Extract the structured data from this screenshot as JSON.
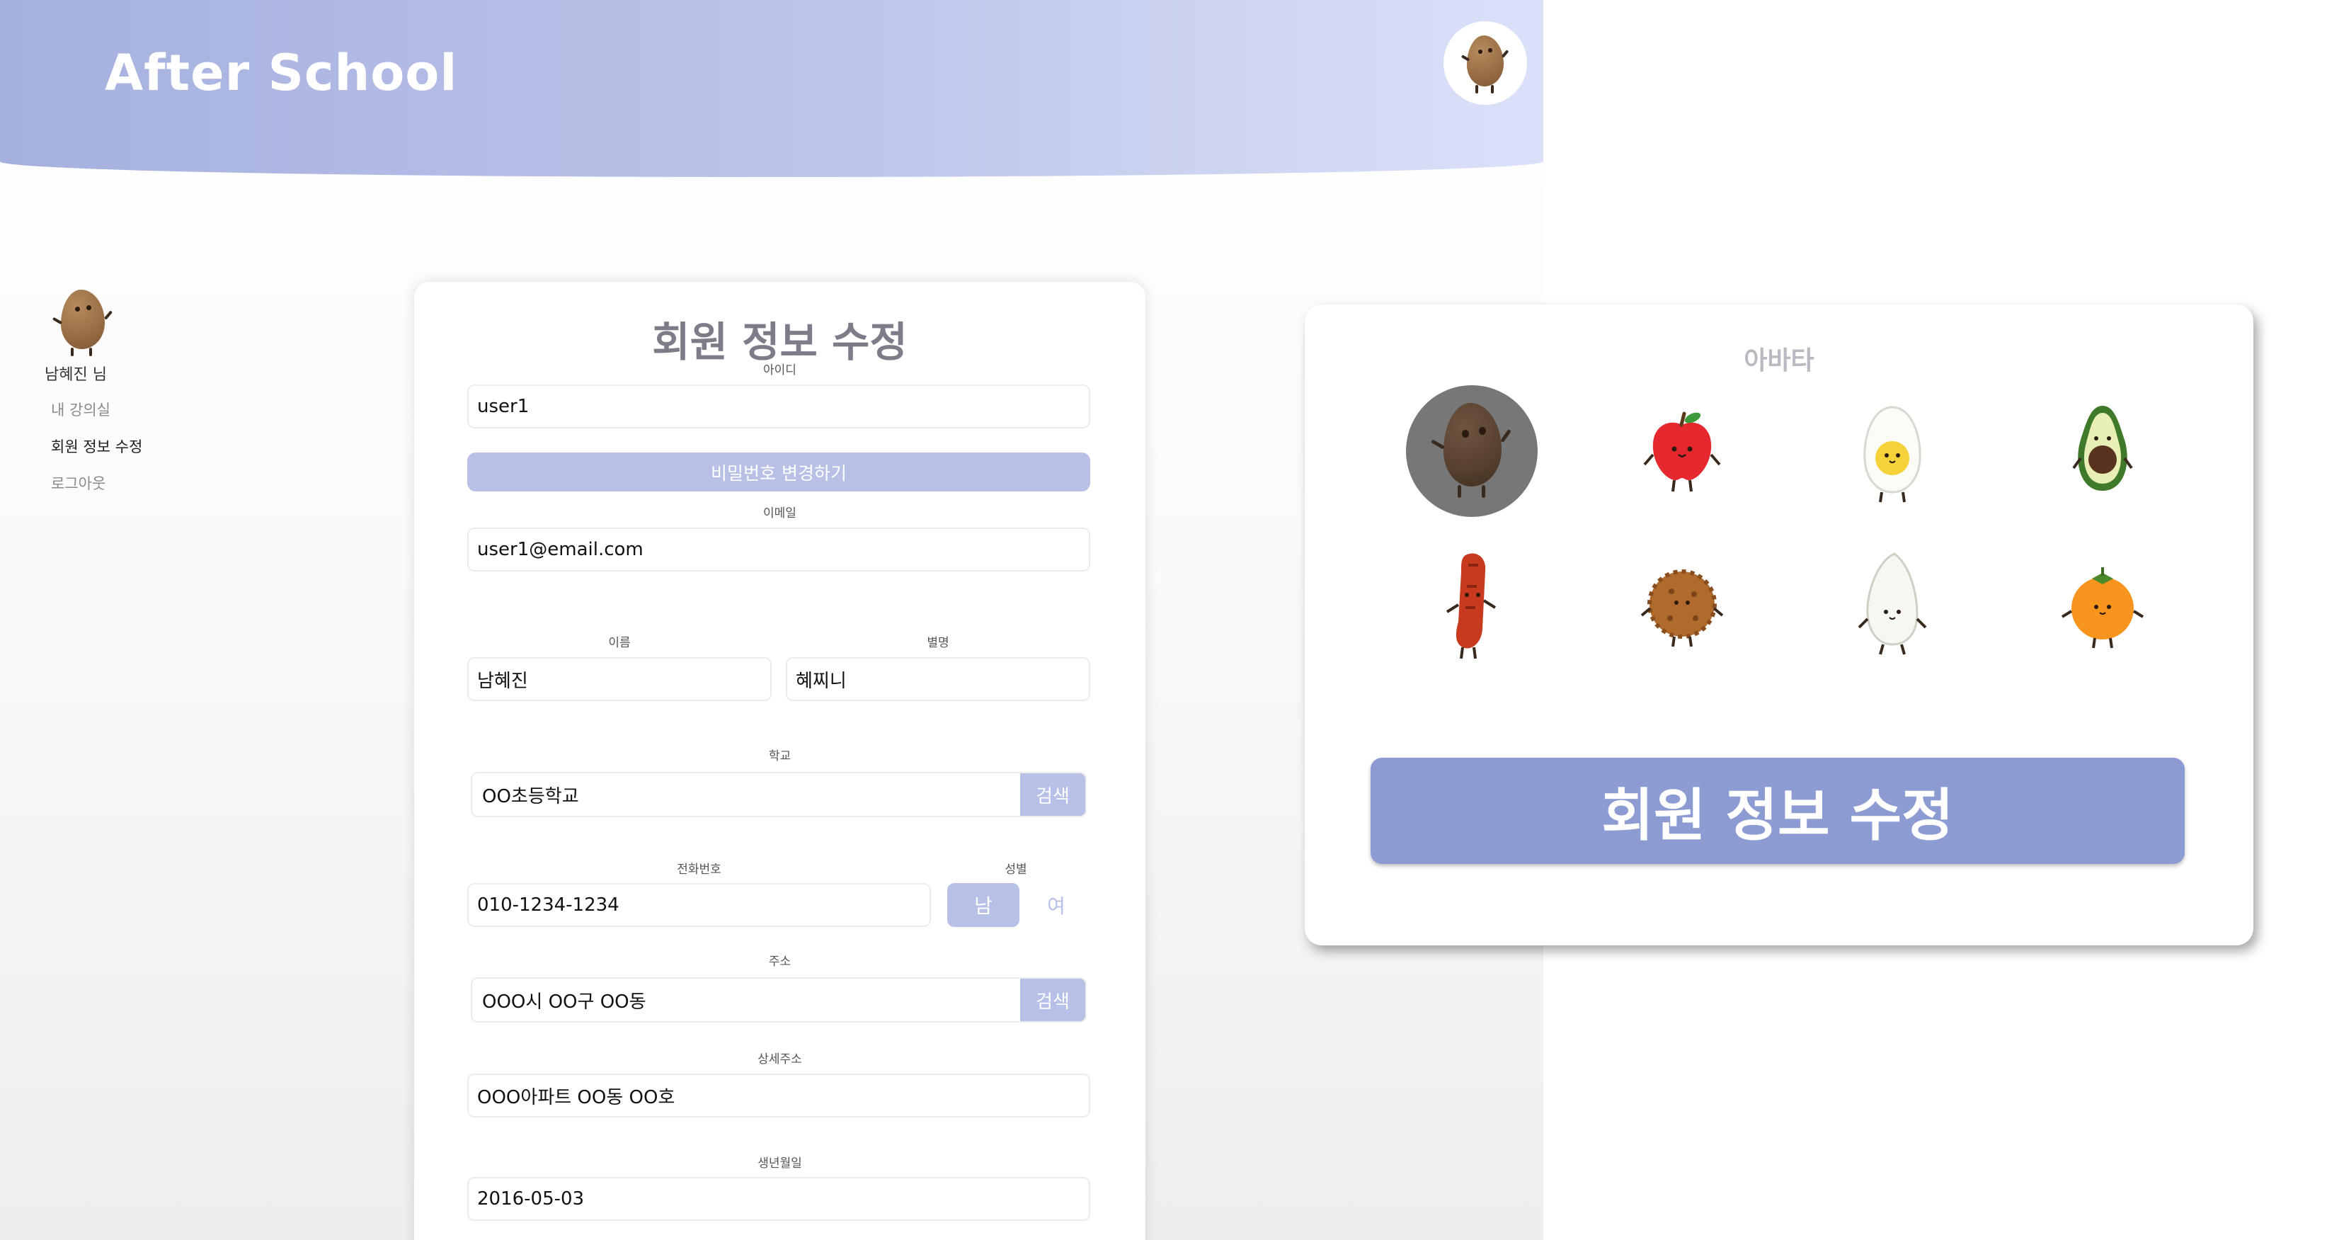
{
  "header": {
    "app_title": "After School"
  },
  "sidebar": {
    "user_name": "남혜진 님",
    "items": [
      {
        "label": "내 강의실"
      },
      {
        "label": "회원 정보 수정"
      },
      {
        "label": "로그아웃"
      }
    ]
  },
  "form": {
    "title": "회원 정보 수정",
    "id": {
      "label": "아이디",
      "value": "user1"
    },
    "password_button": "비밀번호 변경하기",
    "email": {
      "label": "이메일",
      "value": "user1@email.com"
    },
    "name": {
      "label": "이름",
      "value": "남혜진"
    },
    "nickname": {
      "label": "별명",
      "value": "혜찌니"
    },
    "school": {
      "label": "학교",
      "value": "OO초등학교",
      "search_label": "검색"
    },
    "phone": {
      "label": "전화번호",
      "value": "010-1234-1234"
    },
    "gender": {
      "label": "성별",
      "male": "남",
      "female": "여",
      "selected": "남"
    },
    "address": {
      "label": "주소",
      "value": "OOO시 OO구 OO동",
      "search_label": "검색"
    },
    "address_detail": {
      "label": "상세주소",
      "value": "OOO아파트 OO동 OO호"
    },
    "birthdate": {
      "label": "생년월일",
      "value": "2016-05-03"
    }
  },
  "avatar_panel": {
    "title": "아바타",
    "options": [
      {
        "icon": "potato-icon",
        "selected": true
      },
      {
        "icon": "apple-icon",
        "selected": false
      },
      {
        "icon": "egg-icon",
        "selected": false
      },
      {
        "icon": "avocado-icon",
        "selected": false
      },
      {
        "icon": "sausage-icon",
        "selected": false
      },
      {
        "icon": "cookie-icon",
        "selected": false
      },
      {
        "icon": "rice-ball-icon",
        "selected": false
      },
      {
        "icon": "orange-icon",
        "selected": false
      }
    ],
    "submit_label": "회원 정보 수정"
  },
  "colors": {
    "header_start": "#a6b0df",
    "header_end": "#dbe1f8",
    "accent": "#b7c0e6",
    "submit": "#8d9bd3"
  }
}
